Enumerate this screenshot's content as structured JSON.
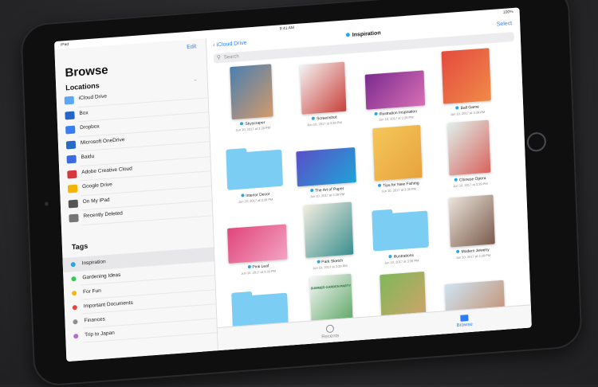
{
  "status_bar": {
    "left": "iPad",
    "center": "9:41 AM",
    "right": "100%"
  },
  "sidebar": {
    "edit_label": "Edit",
    "title": "Browse",
    "locations_header": "Locations",
    "locations": [
      {
        "label": "iCloud Drive",
        "icon": "cloud-icon",
        "color": "#5aa7f5"
      },
      {
        "label": "Box",
        "icon": "box-icon",
        "color": "#2566c8"
      },
      {
        "label": "Dropbox",
        "icon": "dropbox-icon",
        "color": "#3a7ef5"
      },
      {
        "label": "Microsoft OneDrive",
        "icon": "onedrive-icon",
        "color": "#2a6ac7"
      },
      {
        "label": "Baidu",
        "icon": "baidu-icon",
        "color": "#3b6be0"
      },
      {
        "label": "Adobe Creative Cloud",
        "icon": "adobe-icon",
        "color": "#d7373f"
      },
      {
        "label": "Google Drive",
        "icon": "google-drive-icon",
        "color": "#f4b400"
      },
      {
        "label": "On My iPad",
        "icon": "ipad-icon",
        "color": "#555555"
      },
      {
        "label": "Recently Deleted",
        "icon": "trash-icon",
        "color": "#777777"
      }
    ],
    "tags_header": "Tags",
    "tags": [
      {
        "label": "Inspiration",
        "color": "#27a5e4",
        "selected": true
      },
      {
        "label": "Gardening Ideas",
        "color": "#34c759",
        "selected": false
      },
      {
        "label": "For Fun",
        "color": "#f2b90c",
        "selected": false
      },
      {
        "label": "Important Documents",
        "color": "#e8453c",
        "selected": false
      },
      {
        "label": "Finances",
        "color": "#8e8e93",
        "selected": false
      },
      {
        "label": "Trip to Japan",
        "color": "#b36ad1",
        "selected": false
      }
    ]
  },
  "main": {
    "back_label": "iCloud Drive",
    "title": "Inspiration",
    "select_label": "Select",
    "search_placeholder": "Search",
    "items": [
      {
        "name": "Skyscraper",
        "date": "Jun 10, 2017 at 3:39 PM",
        "kind": "image",
        "colors": [
          "#4a7fb0",
          "#d39a6b"
        ]
      },
      {
        "name": "Screenshot",
        "date": "Jun 10, 2017 at 3:39 PM",
        "kind": "image",
        "colors": [
          "#f3f3f3",
          "#c9403a"
        ]
      },
      {
        "name": "Illustration Inspiration",
        "date": "Jun 10, 2017 at 3:39 PM",
        "kind": "image",
        "colors": [
          "#7a2a8e",
          "#d86fb5"
        ]
      },
      {
        "name": "Ball Game",
        "date": "Jun 10, 2017 at 3:39 PM",
        "kind": "image",
        "colors": [
          "#e44a3e",
          "#f08a48"
        ]
      },
      {
        "name": "Interior Decor",
        "date": "Jun 10, 2017 at 3:39 PM",
        "kind": "folder"
      },
      {
        "name": "The Art of Paper",
        "date": "Jun 10, 2017 at 3:39 PM",
        "kind": "image",
        "colors": [
          "#5a4fc6",
          "#1fa3d8"
        ]
      },
      {
        "name": "Tips for New Fishing",
        "date": "Jun 10, 2017 at 3:39 PM",
        "kind": "image",
        "colors": [
          "#f5c75a",
          "#e7a33d"
        ]
      },
      {
        "name": "Chinese Opera",
        "date": "Jun 10, 2017 at 3:39 PM",
        "kind": "image",
        "colors": [
          "#dff1ec",
          "#d9635d"
        ]
      },
      {
        "name": "Pink Leaf",
        "date": "Jun 10, 2017 at 3:39 PM",
        "kind": "image",
        "colors": [
          "#e0457a",
          "#f4a3c2"
        ]
      },
      {
        "name": "Park Sketch",
        "date": "Jun 10, 2017 at 3:39 PM",
        "kind": "image",
        "colors": [
          "#f3ece0",
          "#3a8f8f"
        ]
      },
      {
        "name": "Illustrations",
        "date": "Jun 10, 2017 at 3:39 PM",
        "kind": "folder"
      },
      {
        "name": "Modern Jewelry",
        "date": "Jun 10, 2017 at 3:39 PM",
        "kind": "image",
        "colors": [
          "#ece4dc",
          "#7a5b4a"
        ]
      },
      {
        "name": "",
        "date": "",
        "kind": "folder"
      },
      {
        "name": "",
        "date": "",
        "kind": "image",
        "colors": [
          "#f7f7f7",
          "#55a25e"
        ]
      },
      {
        "name": "",
        "date": "",
        "kind": "image",
        "colors": [
          "#7fb85a",
          "#d3a26a"
        ]
      },
      {
        "name": "",
        "date": "",
        "kind": "image",
        "colors": [
          "#cfe4f2",
          "#c39073"
        ]
      }
    ],
    "extra_card_text": "SUMMER GARDEN PARTY"
  },
  "tabbar": {
    "recents_label": "Recents",
    "browse_label": "Browse"
  },
  "accent": "#2f7cf6"
}
